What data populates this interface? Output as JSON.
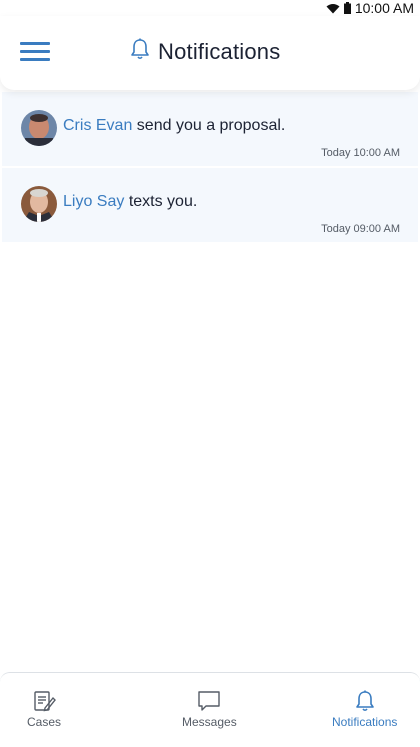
{
  "status_bar": {
    "time": "10:00 AM"
  },
  "header": {
    "title": "Notifications",
    "title_icon": "bell-icon",
    "menu_icon": "hamburger-menu-icon"
  },
  "notifications": [
    {
      "name": "Cris Evan",
      "message": " send you a proposal.",
      "time": "Today 10:00 AM",
      "avatar": "avatar"
    },
    {
      "name": "Liyo Say",
      "message": " texts you.",
      "time": "Today 09:00 AM",
      "avatar": "avatar"
    }
  ],
  "bottom_nav": {
    "items": [
      {
        "label": "Cases",
        "icon": "document-edit-icon",
        "active": false
      },
      {
        "label": "Messages",
        "icon": "chat-bubble-icon",
        "active": false
      },
      {
        "label": "Notifications",
        "icon": "bell-icon",
        "active": true
      }
    ]
  },
  "colors": {
    "accent": "#3a7cc0",
    "card_background": "#f4f8fd",
    "text": "#1c2233"
  }
}
